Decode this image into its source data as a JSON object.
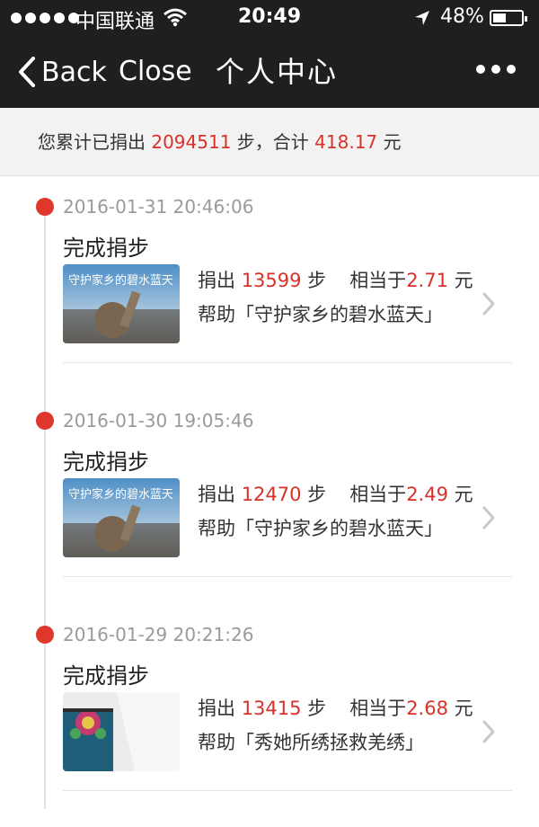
{
  "status_bar": {
    "carrier": "中国联通",
    "time": "20:49",
    "battery": "48%"
  },
  "nav": {
    "back_label": "Back",
    "close_label": "Close",
    "title": "个人中心"
  },
  "summary": {
    "prefix": "您累计已捐出 ",
    "steps": "2094511",
    "mid": " 步，合计 ",
    "amount": "418.17",
    "suffix": " 元"
  },
  "entries": [
    {
      "date": "2016-01-31 20:46:06",
      "action": "完成捐步",
      "donate_label": "捐出 ",
      "steps": "13599",
      "steps_unit": " 步",
      "equiv_label": "相当于",
      "amount": "2.71",
      "amount_unit": " 元",
      "help_text": "帮助「守护家乡的碧水蓝天」",
      "thumb_text": "守护家乡的碧水蓝天"
    },
    {
      "date": "2016-01-30 19:05:46",
      "action": "完成捐步",
      "donate_label": "捐出 ",
      "steps": "12470",
      "steps_unit": " 步",
      "equiv_label": "相当于",
      "amount": "2.49",
      "amount_unit": " 元",
      "help_text": "帮助「守护家乡的碧水蓝天」",
      "thumb_text": "守护家乡的碧水蓝天"
    },
    {
      "date": "2016-01-29 20:21:26",
      "action": "完成捐步",
      "donate_label": "捐出 ",
      "steps": "13415",
      "steps_unit": " 步",
      "equiv_label": "相当于",
      "amount": "2.68",
      "amount_unit": " 元",
      "help_text": "帮助「秀她所绣拯救羌绣」"
    }
  ],
  "colors": {
    "accent_red": "#d9312a",
    "timeline_dot": "#e0372c",
    "nav_bg": "#1f1f21"
  },
  "icons": [
    "signal-dots-icon",
    "wifi-icon",
    "location-arrow-icon",
    "battery-icon",
    "back-chevron-icon",
    "more-dots-icon",
    "chevron-right-icon"
  ]
}
